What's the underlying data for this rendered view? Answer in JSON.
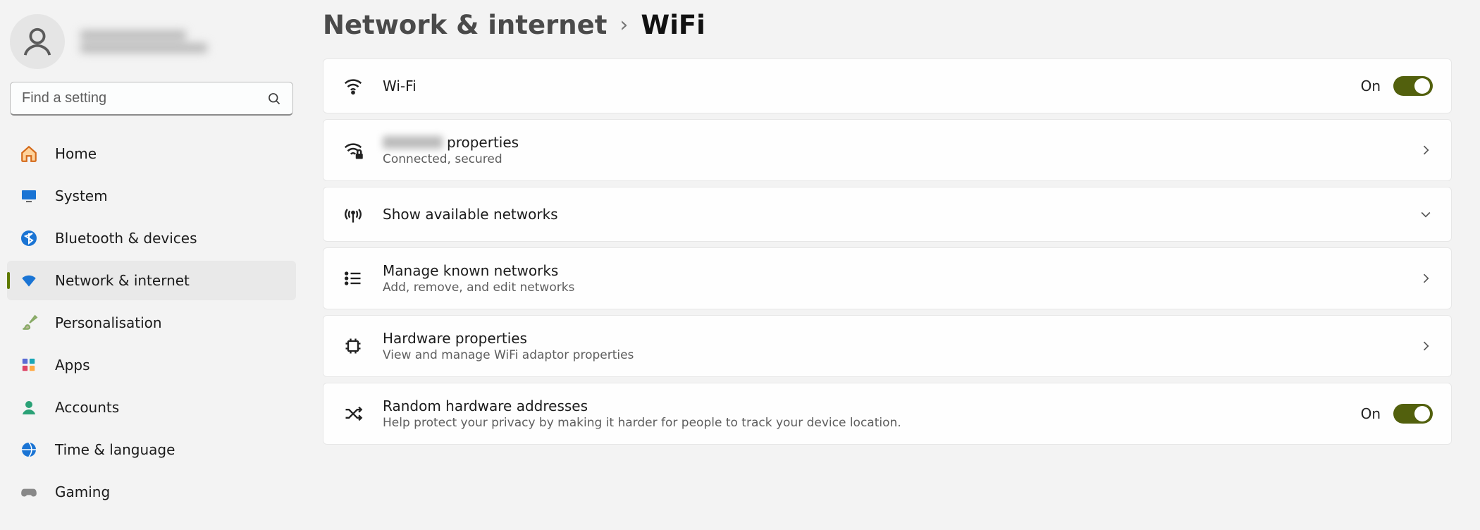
{
  "search": {
    "placeholder": "Find a setting"
  },
  "nav": {
    "items": [
      {
        "label": "Home"
      },
      {
        "label": "System"
      },
      {
        "label": "Bluetooth & devices"
      },
      {
        "label": "Network & internet"
      },
      {
        "label": "Personalisation"
      },
      {
        "label": "Apps"
      },
      {
        "label": "Accounts"
      },
      {
        "label": "Time & language"
      },
      {
        "label": "Gaming"
      }
    ]
  },
  "breadcrumb": {
    "parent": "Network & internet",
    "current": "WiFi"
  },
  "wifi_row": {
    "title": "Wi-Fi",
    "state": "On"
  },
  "properties_row": {
    "suffix": "properties",
    "subtitle": "Connected, secured"
  },
  "available_row": {
    "title": "Show available networks"
  },
  "known_row": {
    "title": "Manage known networks",
    "subtitle": "Add, remove, and edit networks"
  },
  "hw_row": {
    "title": "Hardware properties",
    "subtitle": "View and manage WiFi adaptor properties"
  },
  "random_row": {
    "title": "Random hardware addresses",
    "subtitle": "Help protect your privacy by making it harder for people to track your device location.",
    "state": "On"
  }
}
